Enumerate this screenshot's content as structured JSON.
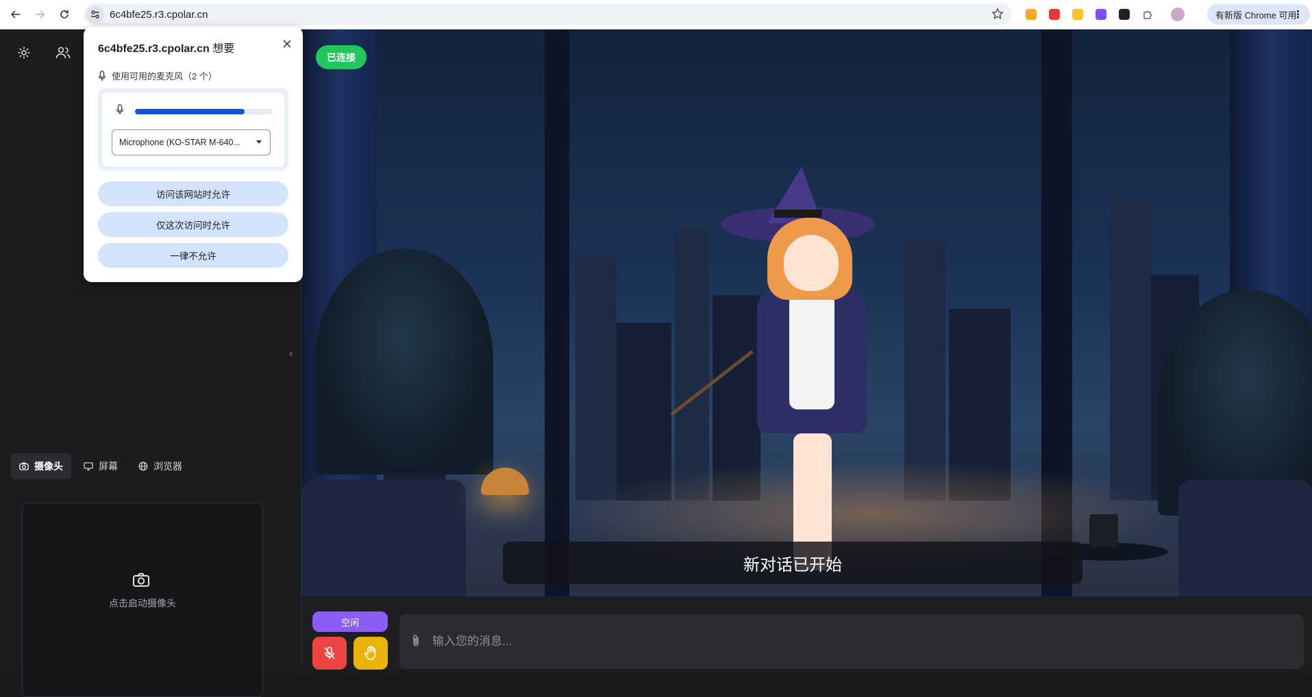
{
  "browser": {
    "url": "6c4bfe25.r3.cpolar.cn",
    "update_label": "有新版 Chrome 可用",
    "extension_colors": [
      "#f9a825",
      "#e53935",
      "#fbc02d",
      "#7c4dff",
      "#212121",
      "#5f6368"
    ]
  },
  "permission_popup": {
    "site": "6c4bfe25.r3.cpolar.cn",
    "wants": "想要",
    "subtitle": "使用可用的麦克风（2 个）",
    "mic_level": 0.8,
    "selected_mic": "Microphone (KO-STAR M-640...",
    "allow_while_visiting": "访问该网站时允许",
    "allow_this_time": "仅这次访问时允许",
    "never_allow": "一律不允许"
  },
  "sidebar": {
    "tabs": [
      {
        "label": "摄像头",
        "icon": "camera-icon"
      },
      {
        "label": "屏幕",
        "icon": "monitor-icon"
      },
      {
        "label": "浏览器",
        "icon": "globe-icon"
      }
    ],
    "camera_placeholder": "点击启动摄像头"
  },
  "main": {
    "connection_status": "已连接",
    "subtitle": "新对话已开始"
  },
  "bottom_bar": {
    "status": "空闲",
    "message_placeholder": "输入您的消息..."
  },
  "colors": {
    "connected": "#22c55e",
    "status_idle": "#8b5cf6",
    "mic_off": "#ef4444",
    "hand": "#eab308",
    "chrome_accent": "#0b57d0"
  }
}
